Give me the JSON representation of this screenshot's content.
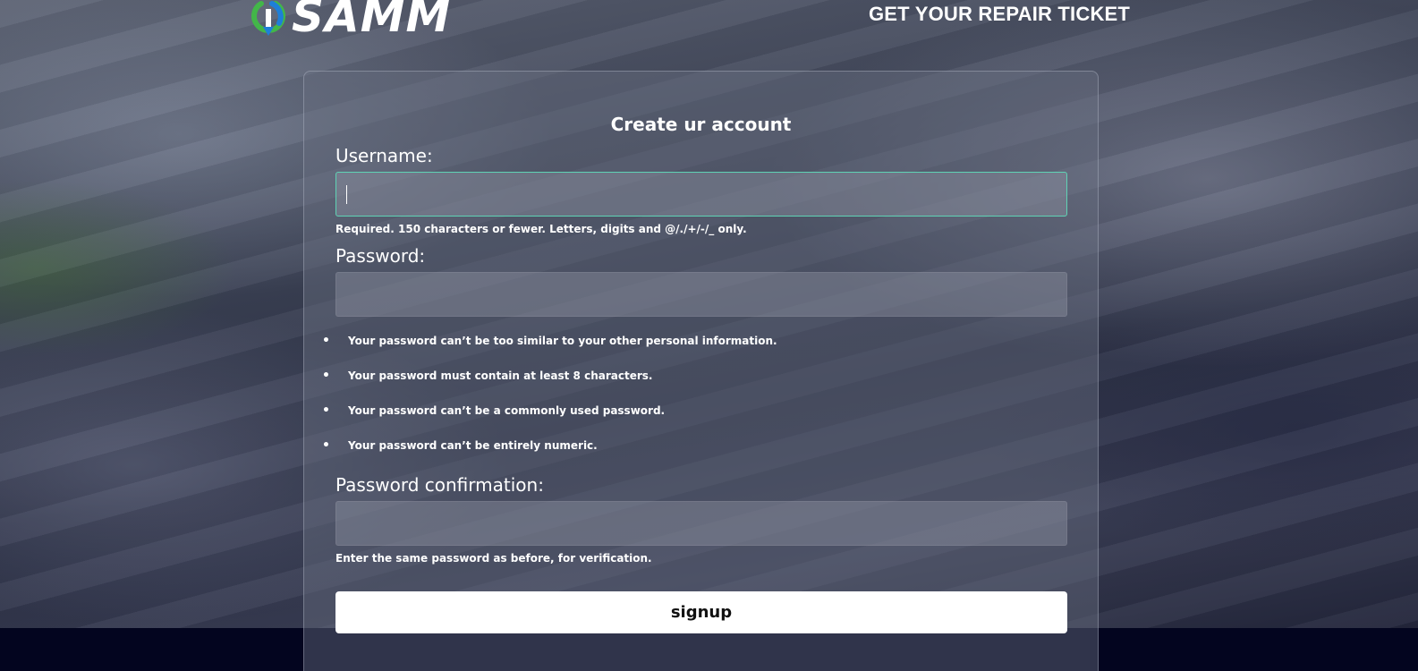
{
  "header": {
    "logo_text": "SAMM",
    "nav_link": "GET YOUR REPAIR TICKET"
  },
  "form": {
    "title": "Create ur account",
    "username": {
      "label": "Username:",
      "value": "",
      "help": "Required. 150 characters or fewer. Letters, digits and @/./+/-/_ only."
    },
    "password": {
      "label": "Password:",
      "value": "",
      "rules": [
        "Your password can’t be too similar to your other personal information.",
        "Your password must contain at least 8 characters.",
        "Your password can’t be a commonly used password.",
        "Your password can’t be entirely numeric."
      ]
    },
    "password_confirmation": {
      "label": "Password confirmation:",
      "value": "",
      "help": "Enter the same password as before, for verification."
    },
    "submit_label": "signup"
  },
  "colors": {
    "focus_border": "#5fd3b5",
    "footer_bg": "#03051f",
    "logo_green": "#43b649",
    "logo_blue": "#1e7fd8"
  }
}
